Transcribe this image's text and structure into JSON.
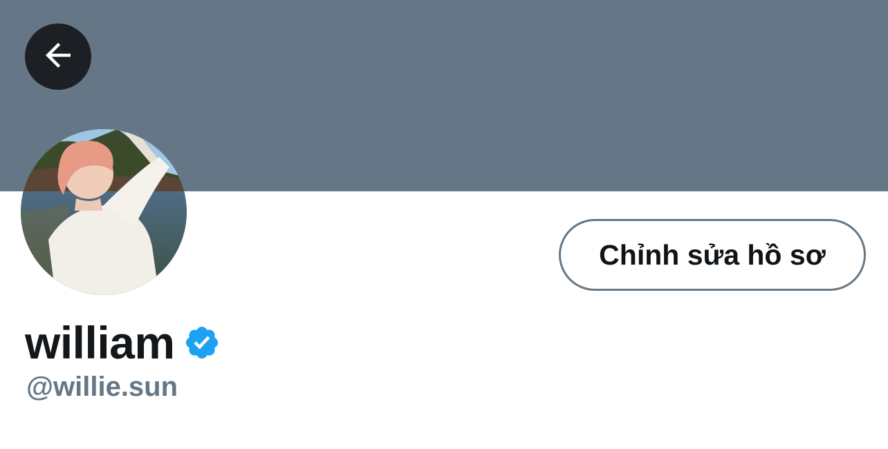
{
  "banner": {
    "color": "#657786"
  },
  "header": {
    "back_icon": "arrow-left-icon"
  },
  "profile": {
    "display_name": "william",
    "handle": "@willie.sun",
    "verified_icon": "verified-badge-icon",
    "verified_color": "#1da1f2"
  },
  "actions": {
    "edit_profile_label": "Chỉnh sửa hồ sơ"
  }
}
